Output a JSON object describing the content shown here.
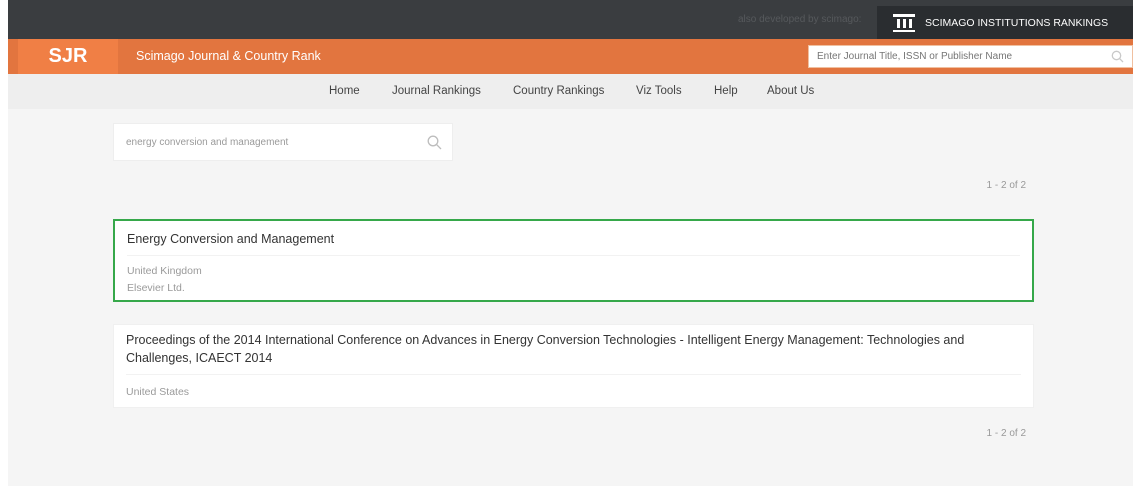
{
  "topbar": {
    "also_developed": "also developed by scimago:",
    "institutions_label": "SCIMAGO INSTITUTIONS RANKINGS"
  },
  "header": {
    "logo": "SJR",
    "title": "Scimago Journal & Country Rank",
    "search_placeholder": "Enter Journal Title, ISSN or Publisher Name"
  },
  "nav": {
    "items": [
      "Home",
      "Journal Rankings",
      "Country Rankings",
      "Viz Tools",
      "Help",
      "About Us"
    ]
  },
  "search": {
    "value": "energy conversion and management"
  },
  "pagination": {
    "top": "1 - 2 of 2",
    "bottom": "1 - 2 of 2"
  },
  "results": [
    {
      "title": "Energy Conversion and Management",
      "country": "United Kingdom",
      "publisher": "Elsevier Ltd."
    },
    {
      "title_line1": "Proceedings of the 2014 International Conference on Advances in Energy Conversion Technologies - Intelligent Energy Management: Technologies and",
      "title_line2": "Challenges, ICAECT 2014",
      "country": "United States"
    }
  ],
  "colors": {
    "orange": "#e2753f",
    "dark": "#3a3d40",
    "highlight": "#36a84a"
  }
}
